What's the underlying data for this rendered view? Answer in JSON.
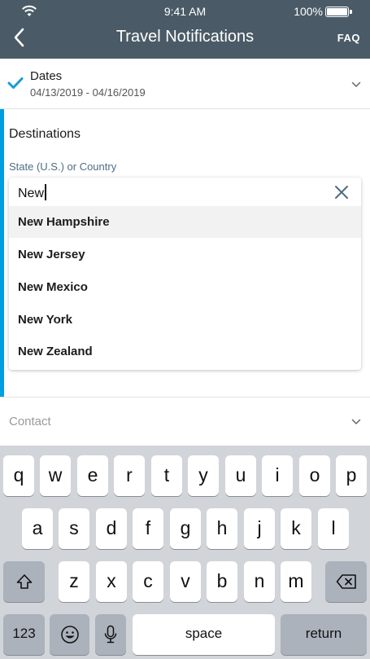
{
  "status_bar": {
    "time": "9:41 AM",
    "battery": "100%"
  },
  "nav": {
    "title": "Travel Notifications",
    "faq": "FAQ"
  },
  "dates": {
    "label": "Dates",
    "value": "04/13/2019 - 04/16/2019"
  },
  "destinations": {
    "title": "Destinations",
    "field_label": "State (U.S.) or Country",
    "input_value": "New",
    "options": [
      "New Hampshire",
      "New Jersey",
      "New Mexico",
      "New York",
      "New Zealand"
    ]
  },
  "contact": {
    "label": "Contact"
  },
  "keyboard": {
    "row1": [
      "q",
      "w",
      "e",
      "r",
      "t",
      "y",
      "u",
      "i",
      "o",
      "p"
    ],
    "row2": [
      "a",
      "s",
      "d",
      "f",
      "g",
      "h",
      "j",
      "k",
      "l"
    ],
    "row3": [
      "z",
      "x",
      "c",
      "v",
      "b",
      "n",
      "m"
    ],
    "numbers_key": "123",
    "space_key": "space",
    "return_key": "return"
  },
  "colors": {
    "nav_bg": "#4a5b67",
    "accent": "#009ee0",
    "check": "#1a9ad6"
  }
}
